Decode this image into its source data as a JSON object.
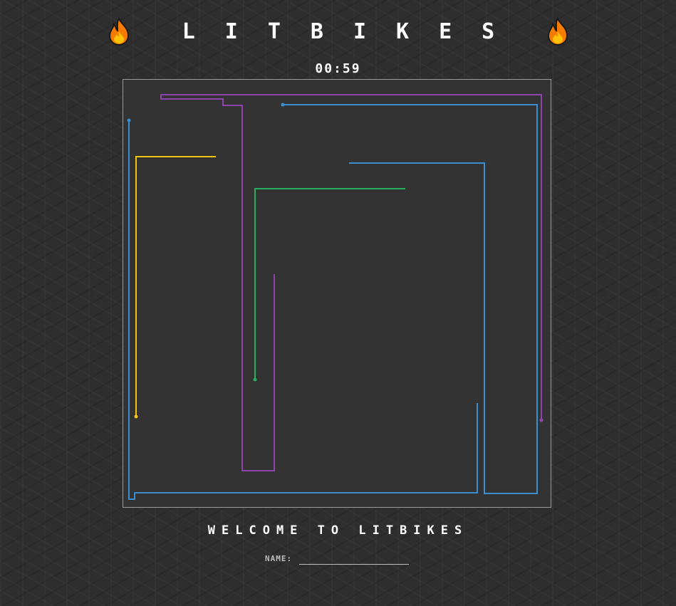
{
  "header": {
    "title": "LITBIKES",
    "left_icon": "fire-icon",
    "right_icon": "fire-icon"
  },
  "timer": {
    "text": "00:59"
  },
  "arena": {
    "background": "#333333",
    "border_color": "#9a9a9a",
    "players": [
      {
        "color": "#8e44ad",
        "name": "purple"
      },
      {
        "color": "#3b8fd0",
        "name": "blue"
      },
      {
        "color": "#f1c40f",
        "name": "yellow"
      },
      {
        "color": "#27ae60",
        "name": "green"
      }
    ]
  },
  "welcome": {
    "text": "WELCOME TO LITBIKES"
  },
  "name_form": {
    "label": "NAME:",
    "value": "",
    "placeholder": ""
  }
}
